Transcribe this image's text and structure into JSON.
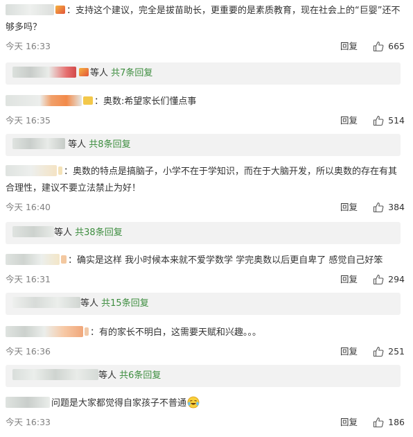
{
  "comments": [
    {
      "text": "：支持这个建议，完全是拔苗助长，更重要的是素质教育，现在社会上的“巨婴”还不够多吗？",
      "time": "今天 16:33",
      "reply_label": "回复",
      "likes": "665",
      "sub": {
        "prefix": "等人",
        "more": "共7条回复"
      }
    },
    {
      "text": "：奥数:希望家长们懂点事",
      "time": "今天 16:35",
      "reply_label": "回复",
      "likes": "514",
      "sub": {
        "prefix": "等人",
        "more": "共8条回复"
      }
    },
    {
      "text": "：奥数的特点是搞脑子，小学不在于学知识，而在于大脑开发，所以奥数的存在有其合理性，建议不要立法禁止为好！",
      "time": "今天 16:40",
      "reply_label": "回复",
      "likes": "384",
      "sub": {
        "prefix": "等人",
        "more": "共38条回复"
      }
    },
    {
      "text": "：确实是这样 我小时候本来就不爱学数学 学完奥数以后更自卑了 感觉自己好笨",
      "time": "今天 16:31",
      "reply_label": "回复",
      "likes": "294",
      "sub": {
        "prefix": "等人",
        "more": "共15条回复"
      }
    },
    {
      "text": "：有的家长不明白，这需要天赋和兴趣。。。",
      "time": "今天 16:36",
      "reply_label": "回复",
      "likes": "251",
      "sub": {
        "prefix": "等人",
        "more": "共6条回复"
      }
    },
    {
      "text": "问题是大家都觉得自家孩子不普通",
      "time": "今天 16:33",
      "reply_label": "回复",
      "likes": "186"
    }
  ],
  "colors": {
    "reply_count": "#3d8d3f",
    "meta_text": "#808080",
    "sub_bg": "#f2f2f2"
  },
  "icons": {
    "like": "thumbs-up-icon",
    "emoji": "laughing-crying-emoji-icon"
  }
}
